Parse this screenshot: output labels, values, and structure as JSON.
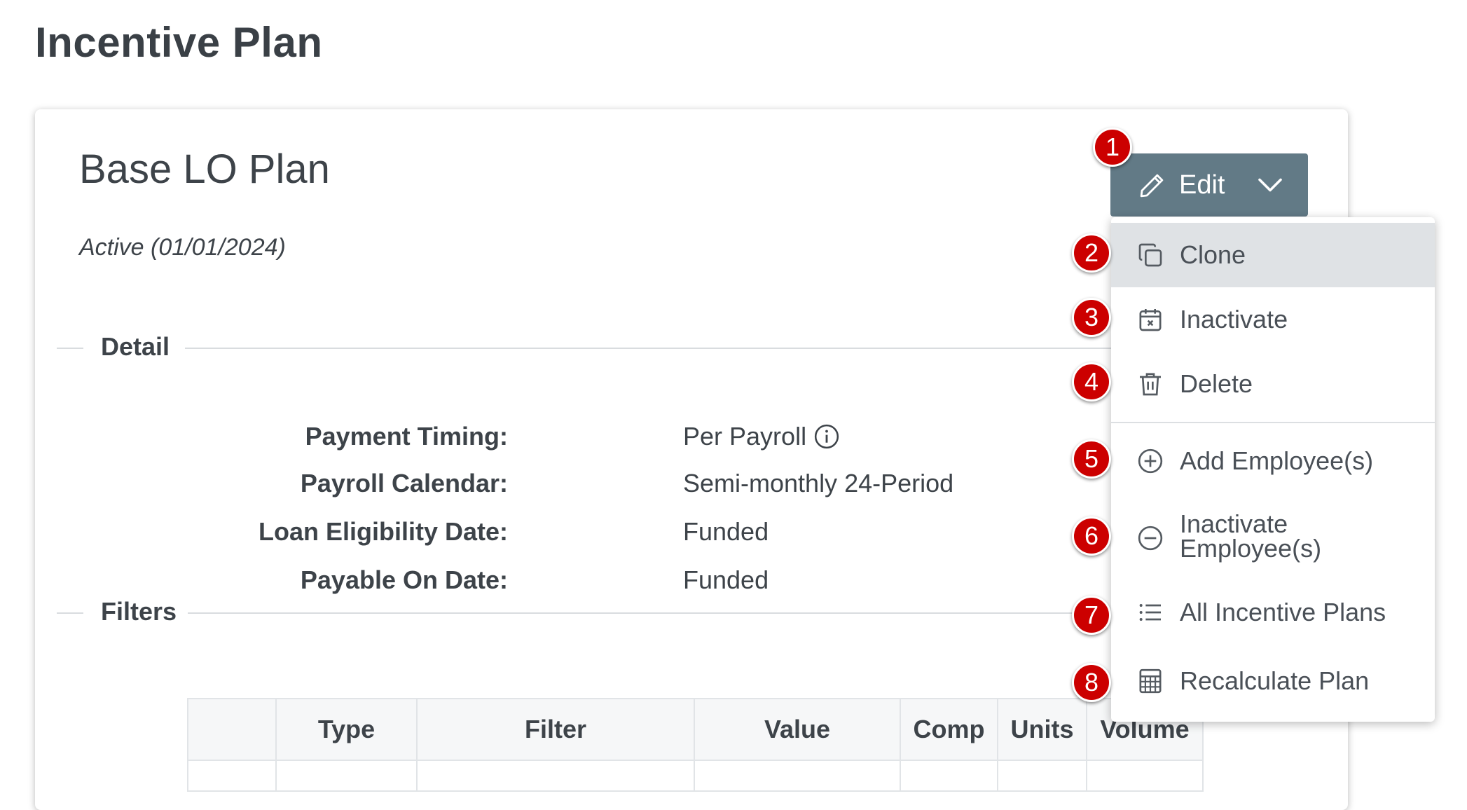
{
  "page": {
    "title": "Incentive Plan"
  },
  "plan": {
    "name": "Base LO Plan",
    "status": "Active (01/01/2024)"
  },
  "sections": {
    "detail": "Detail",
    "filters": "Filters"
  },
  "detail": [
    {
      "label": "Payment Timing:",
      "value": "Per Payroll",
      "info_icon": "info-circle-icon"
    },
    {
      "label": "Payroll Calendar:",
      "value": "Semi-monthly 24-Period"
    },
    {
      "label": "Loan Eligibility Date:",
      "value": "Funded"
    },
    {
      "label": "Payable On Date:",
      "value": "Funded"
    }
  ],
  "filters_table": {
    "columns": [
      "",
      "Type",
      "Filter",
      "Value",
      "Comp",
      "Units",
      "Volume"
    ]
  },
  "edit_button": {
    "label": "Edit",
    "icon": "pencil-icon",
    "toggle_icon": "chevron-down-icon",
    "color": "#627a86"
  },
  "menu": {
    "items": [
      {
        "label": "Clone",
        "icon": "copy-icon"
      },
      {
        "label": "Inactivate",
        "icon": "calendar-x-icon"
      },
      {
        "label": "Delete",
        "icon": "trash-icon"
      },
      {
        "label": "Add Employee(s)",
        "icon": "plus-circle-icon"
      },
      {
        "label_line1": "Inactivate",
        "label_line2": "Employee(s)",
        "icon": "minus-circle-icon"
      },
      {
        "label": "All Incentive Plans",
        "icon": "list-icon"
      },
      {
        "label": "Recalculate Plan",
        "icon": "calculator-icon"
      }
    ]
  },
  "badges": [
    "1",
    "2",
    "3",
    "4",
    "5",
    "6",
    "7",
    "8"
  ],
  "colors": {
    "badge": "#cc0000",
    "menu_active": "#dfe2e5",
    "text": "#3d4349"
  }
}
